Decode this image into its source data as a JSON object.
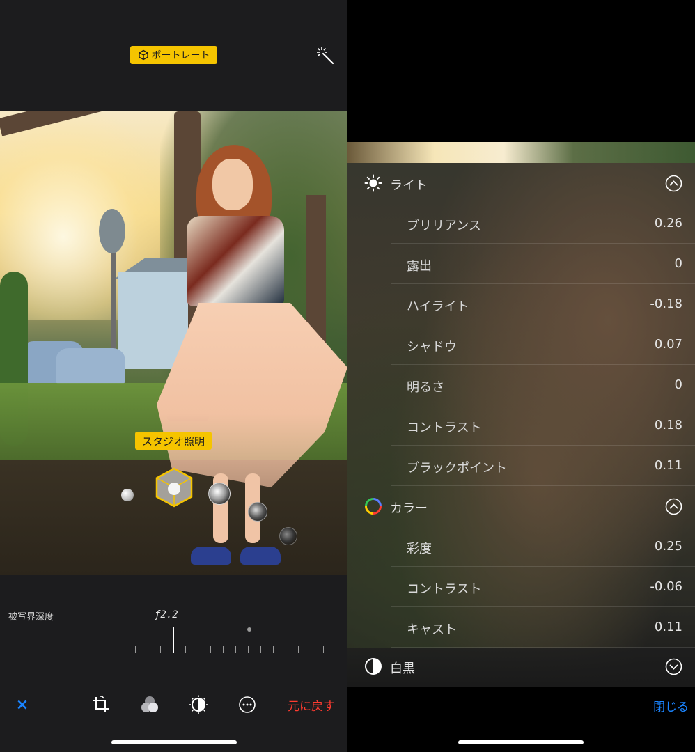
{
  "left": {
    "portrait_badge": "ポートレート",
    "studio_light_label": "スタジオ照明",
    "depth": {
      "label": "被写界深度",
      "value": "ƒ2.2"
    },
    "toolbar": {
      "cancel_label": "×",
      "revert_label": "元に戻す"
    }
  },
  "right": {
    "sections": [
      {
        "title": "ライト",
        "icon": "sun-icon",
        "expanded": true,
        "items": [
          {
            "label": "ブリリアンス",
            "value": "0.26"
          },
          {
            "label": "露出",
            "value": "0"
          },
          {
            "label": "ハイライト",
            "value": "-0.18"
          },
          {
            "label": "シャドウ",
            "value": "0.07"
          },
          {
            "label": "明るさ",
            "value": "0"
          },
          {
            "label": "コントラスト",
            "value": "0.18"
          },
          {
            "label": "ブラックポイント",
            "value": "0.11"
          }
        ]
      },
      {
        "title": "カラー",
        "icon": "color-wheel-icon",
        "expanded": true,
        "items": [
          {
            "label": "彩度",
            "value": "0.25"
          },
          {
            "label": "コントラスト",
            "value": "-0.06"
          },
          {
            "label": "キャスト",
            "value": "0.11"
          }
        ]
      },
      {
        "title": "白黒",
        "icon": "half-circle-icon",
        "expanded": false,
        "items": []
      }
    ],
    "close_label": "閉じる"
  },
  "colors": {
    "accent_yellow": "#f5c400",
    "link_blue": "#1a84ff",
    "revert_red": "#ff3b30"
  }
}
